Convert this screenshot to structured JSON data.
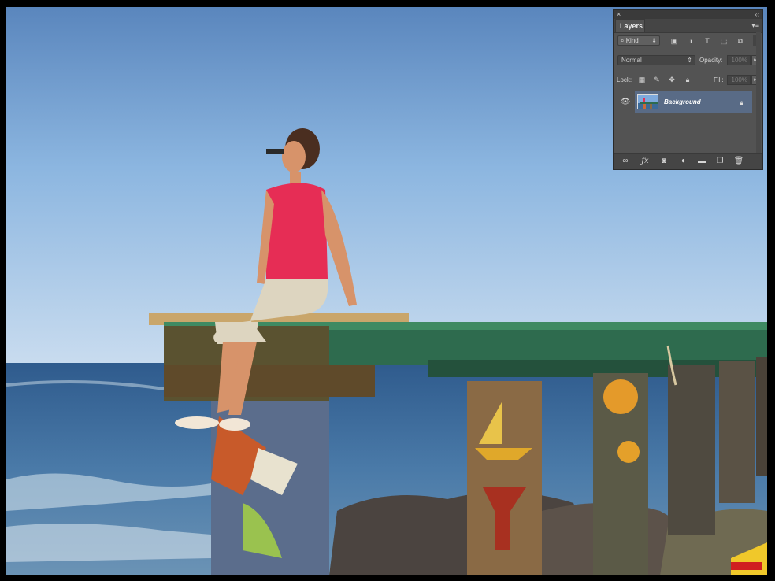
{
  "panel": {
    "close_glyph": "×",
    "collapse_glyph": "‹‹",
    "tab_label": "Layers",
    "menu_glyph": "▾≡",
    "filter": {
      "kind_label": "⌕ Kind",
      "kind_arrow": "⇕",
      "icons": [
        "image-filter-icon",
        "adjustment-filter-icon",
        "type-filter-icon",
        "shape-filter-icon",
        "smart-object-filter-icon"
      ]
    },
    "blend_mode": "Normal",
    "opacity_label": "Opacity:",
    "opacity_value": "100%",
    "lock_label": "Lock:",
    "fill_label": "Fill:",
    "fill_value": "100%",
    "layer": {
      "name": "Background",
      "visible": true,
      "locked": true
    },
    "bottom_icons": [
      "link-layers-icon",
      "fx-icon",
      "add-mask-icon",
      "adjustment-layer-icon",
      "new-group-icon",
      "new-layer-icon",
      "delete-layer-icon"
    ]
  },
  "colors": {
    "panel_bg": "#535353",
    "selected_layer": "#596b86",
    "sky_top": "#5b84b8",
    "sea": "#3b6a99"
  }
}
